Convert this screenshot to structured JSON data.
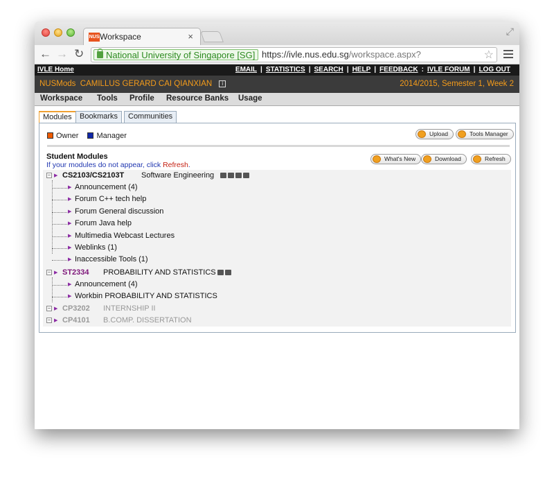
{
  "browser": {
    "tab_title": "Workspace",
    "tab_favicon_text": "NUS",
    "ev_label": "National University of Singapore [SG]",
    "url_prefix": "https://",
    "url_host": "ivle.nus.edu.sg",
    "url_path": "/workspace.aspx?"
  },
  "topbar": {
    "home": "IVLE Home",
    "links": [
      "EMAIL",
      "STATISTICS",
      "SEARCH",
      "HELP",
      "FEEDBACK",
      "IVLE FORUM",
      "LOG OUT"
    ]
  },
  "userbar": {
    "app": "NUSMods",
    "user": "CAMILLUS GERARD CAI QIANXIAN",
    "semester": "2014/2015, Semester 1, Week 2"
  },
  "mainmenu": [
    "Workspace",
    "Tools",
    "Profile",
    "Resource Banks",
    "Usage"
  ],
  "page_tabs": [
    "Modules",
    "Bookmarks",
    "Communities"
  ],
  "legend": {
    "owner": "Owner",
    "manager": "Manager",
    "owner_color": "#ee5a00",
    "manager_color": "#1027a8"
  },
  "buttons": {
    "upload": "Upload",
    "tools_manager": "Tools Manager",
    "whats_new": "What's New",
    "download": "Download",
    "refresh": "Refresh"
  },
  "student_modules": {
    "title": "Student Modules",
    "hint_prefix": "If your modules do not appear, click ",
    "hint_link": "Refresh",
    "hint_suffix": ".",
    "modules": [
      {
        "code": "CS2103/CS2103T",
        "name": "Software Engineering",
        "items": [
          {
            "type": "Announcement",
            "name": "(4)"
          },
          {
            "type": "Forum",
            "name": "C++ tech help"
          },
          {
            "type": "Forum",
            "name": "General discussion"
          },
          {
            "type": "Forum",
            "name": "Java help"
          },
          {
            "type": "Multimedia",
            "name": "Webcast Lectures"
          },
          {
            "type": "Weblinks",
            "name": "(1)"
          },
          {
            "type": "Inaccessible Tools",
            "name": "(1)"
          }
        ]
      },
      {
        "code": "ST2334",
        "name": "PROBABILITY AND STATISTICS",
        "items": [
          {
            "type": "Announcement",
            "name": "(4)"
          },
          {
            "type": "Workbin",
            "name": "PROBABILITY AND STATISTICS"
          }
        ]
      },
      {
        "code": "CP3202",
        "name": "INTERNSHIP II",
        "items": []
      },
      {
        "code": "CP4101",
        "name": "B.COMP. DISSERTATION",
        "items": []
      }
    ]
  }
}
